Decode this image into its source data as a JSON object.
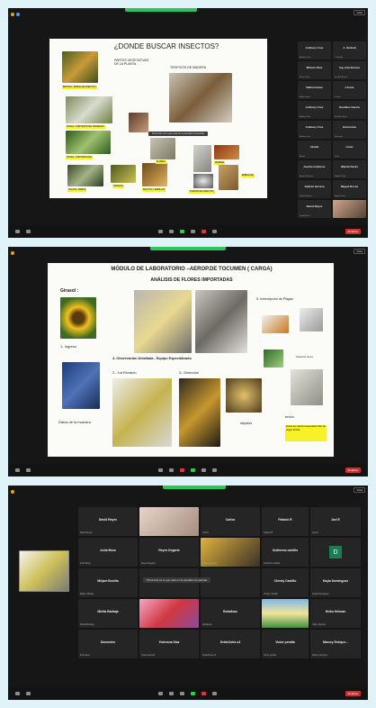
{
  "meeting": {
    "end_label": "Finalizar",
    "view_label": "Vista",
    "share_banner": "Pizza Kits es lo que está en la pantalla compartida"
  },
  "slide1": {
    "title": "¿DONDE BUSCAR INSECTOS?",
    "plant_parts": "PARTES VEGETATIVAS DE LA PLANTA",
    "wood": "TROPICOS DE MADERA",
    "labels": [
      "BROTES / ROBLE DE INSECTOS",
      "HOJAS / CONTRAHOJAS HORMIGAS",
      "HOJAS / CONTRAHOJAS",
      "FLORES",
      "TALLOS / RAMAS",
      "HONGOS",
      "FRUTOS Y SEMILLAS",
      "PUENTE DE INSECTOS",
      "MADERA",
      "EMBALAJE"
    ],
    "participants": [
      {
        "name": "Anthony Cruz",
        "sub": "Anthony Cruz"
      },
      {
        "name": "J. Verdedi",
        "sub": "J. Verdedi"
      },
      {
        "name": "Mirtaco Diaz",
        "sub": "Mirtaco Diaz"
      },
      {
        "name": "Ing. Ada Burcea",
        "sub": "Ing. Ada Burcea"
      },
      {
        "name": "Vallini Ivimeo",
        "sub": "Vallini Ivimeo"
      },
      {
        "name": "J.Carlo",
        "sub": "J.Carlo"
      },
      {
        "name": "Anthony Cruz",
        "sub": "Anthony Cruz"
      },
      {
        "name": "Euclides Garcia",
        "sub": "Euclides Garcia"
      },
      {
        "name": "Anthony Cruz",
        "sub": "Anthony Cruz"
      },
      {
        "name": "Entrevista",
        "sub": "Entrevista"
      },
      {
        "name": "Abrahi",
        "sub": "Abrahi"
      },
      {
        "name": "Lhaio",
        "sub": "Lhaio"
      },
      {
        "name": "Aurelio Gutierrez",
        "sub": "Aurelio Gutierrez"
      },
      {
        "name": "Wanda Pardo",
        "sub": "Wanda Pardo"
      },
      {
        "name": "Gabriel Herrera",
        "sub": "Gabriel Herrera"
      },
      {
        "name": "Miguel Rosas",
        "sub": "Miguel Rosas"
      },
      {
        "name": "David Reyes",
        "sub": "David Reyes"
      }
    ]
  },
  "slide2": {
    "title": "MÓDULO DE LABORATORIO –AEROP.DE TOCUMEN ( CARGA)",
    "subtitle": "ANÁLISIS DE FLORES IMPORTADAS",
    "girasol": "Girasol :",
    "ingreso": "1- Ingreso",
    "step2": "2.- 1ra Revisión",
    "step3": "3.- Disección",
    "step4": "4- Observación Detallada - Equipo Especializado",
    "step5": "5- Intercepción de Plagas",
    "datos": "Datos de la muestra",
    "insectos": "Insectos vivos",
    "envio": "envío",
    "yellow_box": "Fecha de colecta Hospedante País de origen Fecha",
    "captions": [
      "Frascos",
      "Pinzas",
      "Pinzas",
      "sépalos",
      "Pasillo",
      "Plantas"
    ]
  },
  "gallery": {
    "participants": [
      {
        "name": "David Reyes",
        "sub": "David Reyes"
      },
      {
        "name": "",
        "sub": "Reyes Degarte"
      },
      {
        "name": "Carlos",
        "sub": "Carlos"
      },
      {
        "name": "Palacio R",
        "sub": "Palacio R"
      },
      {
        "name": "Jael E",
        "sub": "Jael E"
      },
      {
        "name": "Anila Mora",
        "sub": "Anila Mora"
      },
      {
        "name": "Reyes Degarte",
        "sub": "Reyes Degarte"
      },
      {
        "name": "",
        "sub": "Reyes Degarte"
      },
      {
        "name": "Guillermo castillo",
        "sub": "Guillermo castillo"
      },
      {
        "name": "",
        "sub": "D"
      },
      {
        "name": "Mirjam Bonilla",
        "sub": "Mirjam Bonilla"
      },
      {
        "name": "",
        "sub": ""
      },
      {
        "name": "",
        "sub": ""
      },
      {
        "name": "Christy Castillo",
        "sub": "Christy Castillo"
      },
      {
        "name": "Kayla Dominguez",
        "sub": "Kayla Dominguez"
      },
      {
        "name": "Mirtila Barbaja",
        "sub": "Mirtila Barbaja"
      },
      {
        "name": "",
        "sub": ""
      },
      {
        "name": "Roladisac",
        "sub": "Roladisac"
      },
      {
        "name": "",
        "sub": ""
      },
      {
        "name": "Heiko Hetman",
        "sub": "Heiko Hetman"
      },
      {
        "name": "Diomedes",
        "sub": "Diomedes"
      },
      {
        "name": "Yolenona Diaz",
        "sub": "Yolenona Diaz"
      },
      {
        "name": "SeideZorte-s3",
        "sub": "SeideZorte-s3"
      },
      {
        "name": "Victor peralta",
        "sub": "Victor peralta"
      },
      {
        "name": "Marcey Enrique...",
        "sub": "Marcey Enrique..."
      }
    ],
    "avatar_letter": "D"
  }
}
